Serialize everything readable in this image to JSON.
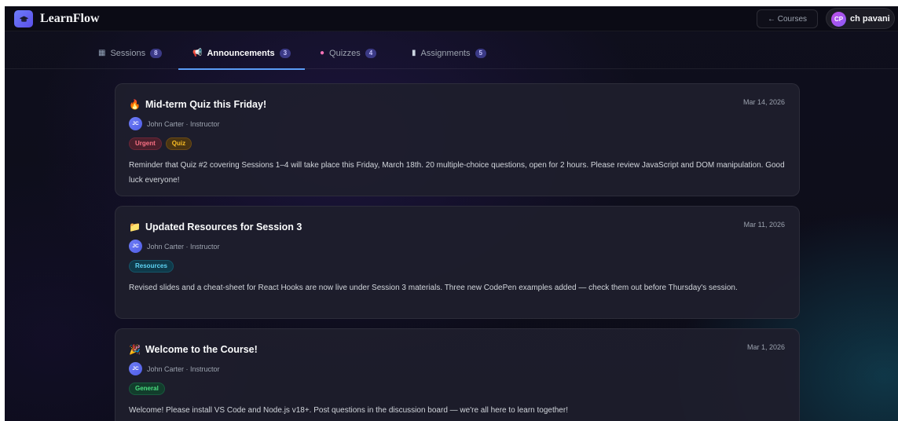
{
  "app": {
    "name": "LearnFlow",
    "logo_icon": "graduation-cap-icon",
    "accent_color": "#5b9cf6"
  },
  "header": {
    "courses_button": "← Courses",
    "user": {
      "initials": "CP",
      "name": "ch pavani"
    }
  },
  "tabs": [
    {
      "label": "Sessions",
      "count": "8",
      "icon": "calendar-icon",
      "glyph": "▦",
      "active": false
    },
    {
      "label": "Announcements",
      "count": "3",
      "icon": "megaphone-icon",
      "glyph": "📢",
      "active": true
    },
    {
      "label": "Quizzes",
      "count": "4",
      "icon": "brain-icon",
      "glyph": "●",
      "active": false
    },
    {
      "label": "Assignments",
      "count": "5",
      "icon": "document-icon",
      "glyph": "▮",
      "active": false
    }
  ],
  "announcements": [
    {
      "emoji": "🔥",
      "emoji_icon": "fire-icon",
      "title": "Mid-term Quiz this Friday!",
      "date": "Mar 14, 2026",
      "author_initials": "JC",
      "author": "John Carter · Instructor",
      "tags": [
        "Urgent",
        "Quiz"
      ],
      "body": "Reminder that Quiz #2 covering Sessions 1–4 will take place this Friday, March 18th. 20 multiple-choice questions, open for 2 hours. Please review JavaScript and DOM manipulation. Good luck everyone!"
    },
    {
      "emoji": "📁",
      "emoji_icon": "folder-icon",
      "title": "Updated Resources for Session 3",
      "date": "Mar 11, 2026",
      "author_initials": "JC",
      "author": "John Carter · Instructor",
      "tags": [
        "Resources"
      ],
      "body": "Revised slides and a cheat-sheet for React Hooks are now live under Session 3 materials. Three new CodePen examples added — check them out before Thursday's session."
    },
    {
      "emoji": "🎉",
      "emoji_icon": "party-popper-icon",
      "title": "Welcome to the Course!",
      "date": "Mar 1, 2026",
      "author_initials": "JC",
      "author": "John Carter · Instructor",
      "tags": [
        "General"
      ],
      "body": "Welcome! Please install VS Code and Node.js v18+. Post questions in the discussion board — we're all here to learn together!"
    }
  ]
}
